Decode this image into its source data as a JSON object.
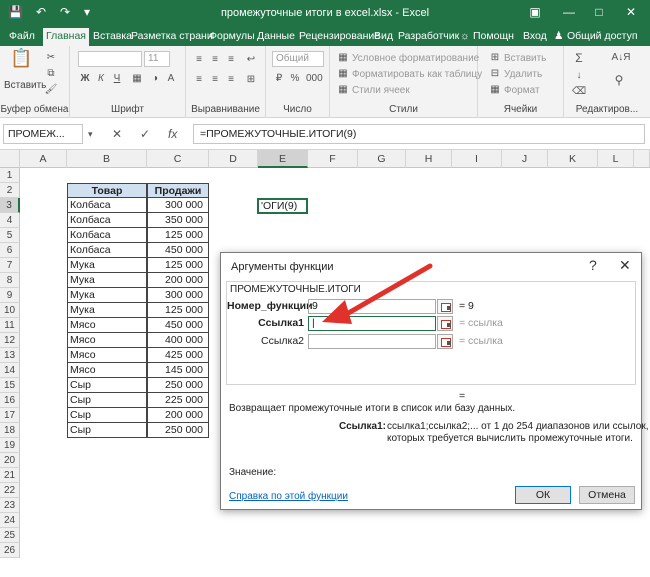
{
  "window": {
    "title": "промежуточные итоги в excel.xlsx - Excel",
    "buttons": {
      "minimize": "—",
      "maximize": "□",
      "close": "✕",
      "ribbon_opts": "▣"
    }
  },
  "quick_access": {
    "save": "💾",
    "undo": "↶",
    "redo": "↷",
    "more": "▾"
  },
  "tabs": [
    "Файл",
    "Главная",
    "Вставка",
    "Разметка страни",
    "Формулы",
    "Данные",
    "Рецензирование",
    "Вид",
    "Разработчик"
  ],
  "active_tab": "Главная",
  "tabs_right": {
    "help": "Помощн",
    "signin": "Вход",
    "share": "Общий доступ"
  },
  "ribbon": {
    "groups": {
      "clipboard": "Буфер обмена",
      "font": "Шрифт",
      "alignment": "Выравнивание",
      "number": "Число",
      "styles": "Стили",
      "cells": "Ячейки",
      "editing": "Редактиров..."
    },
    "paste_label": "Вставить",
    "font_size": "11",
    "number_format": "Общий",
    "styles_items": [
      "Условное форматирование",
      "Форматировать как таблицу",
      "Стили ячеек"
    ],
    "cells_items": [
      "Вставить",
      "Удалить",
      "Формат"
    ]
  },
  "formula_bar": {
    "name_box": "ПРОМЕЖ...",
    "cancel": "✕",
    "enter": "✓",
    "fx": "fx",
    "formula": "=ПРОМЕЖУТОЧНЫЕ.ИТОГИ(9)"
  },
  "sheet": {
    "columns": [
      "A",
      "B",
      "C",
      "D",
      "E",
      "F",
      "G",
      "H",
      "I",
      "J",
      "K",
      "L"
    ],
    "rows": [
      "1",
      "2",
      "3",
      "4",
      "5",
      "6",
      "7",
      "8",
      "9",
      "10",
      "11",
      "12",
      "13",
      "14",
      "15",
      "16",
      "17",
      "18",
      "19",
      "20",
      "21",
      "22",
      "23",
      "24",
      "25",
      "26"
    ],
    "table_headers": [
      "Товар",
      "Продажи"
    ],
    "table_rows": [
      [
        "Колбаса",
        "300 000"
      ],
      [
        "Колбаса",
        "350 000"
      ],
      [
        "Колбаса",
        "125 000"
      ],
      [
        "Колбаса",
        "450 000"
      ],
      [
        "Мука",
        "125 000"
      ],
      [
        "Мука",
        "200 000"
      ],
      [
        "Мука",
        "300 000"
      ],
      [
        "Мука",
        "125 000"
      ],
      [
        "Мясо",
        "450 000"
      ],
      [
        "Мясо",
        "400 000"
      ],
      [
        "Мясо",
        "425 000"
      ],
      [
        "Мясо",
        "145 000"
      ],
      [
        "Сыр",
        "250 000"
      ],
      [
        "Сыр",
        "225 000"
      ],
      [
        "Сыр",
        "200 000"
      ],
      [
        "Сыр",
        "250 000"
      ]
    ],
    "active_cell_text": "'ОГИ(9)"
  },
  "dialog": {
    "title": "Аргументы функции",
    "help_glyph": "?",
    "close_glyph": "✕",
    "function_name": "ПРОМЕЖУТОЧНЫЕ.ИТОГИ",
    "args": [
      {
        "label": "Номер_функции",
        "value": "9",
        "result": "= 9",
        "bold": true
      },
      {
        "label": "Ссылка1",
        "value": "|",
        "result": "= ссылка",
        "bold": true
      },
      {
        "label": "Ссылка2",
        "value": "",
        "result": "= ссылка",
        "bold": false
      }
    ],
    "result_eq": "=",
    "description": "Возвращает промежуточные итоги в список или базу данных.",
    "arg_desc_label": "Ссылка1:",
    "arg_desc_line1": "ссылка1;ссылка2;... от 1 до 254 диапазонов или ссылок, для",
    "arg_desc_line2": "которых требуется вычислить промежуточные итоги.",
    "value_label": "Значение:",
    "help_link": "Справка по этой функции",
    "ok": "ОК",
    "cancel": "Отмена"
  },
  "colors": {
    "excel_green": "#217346",
    "arrow_red": "#e0322b",
    "header_fill": "#d0e0f0"
  }
}
